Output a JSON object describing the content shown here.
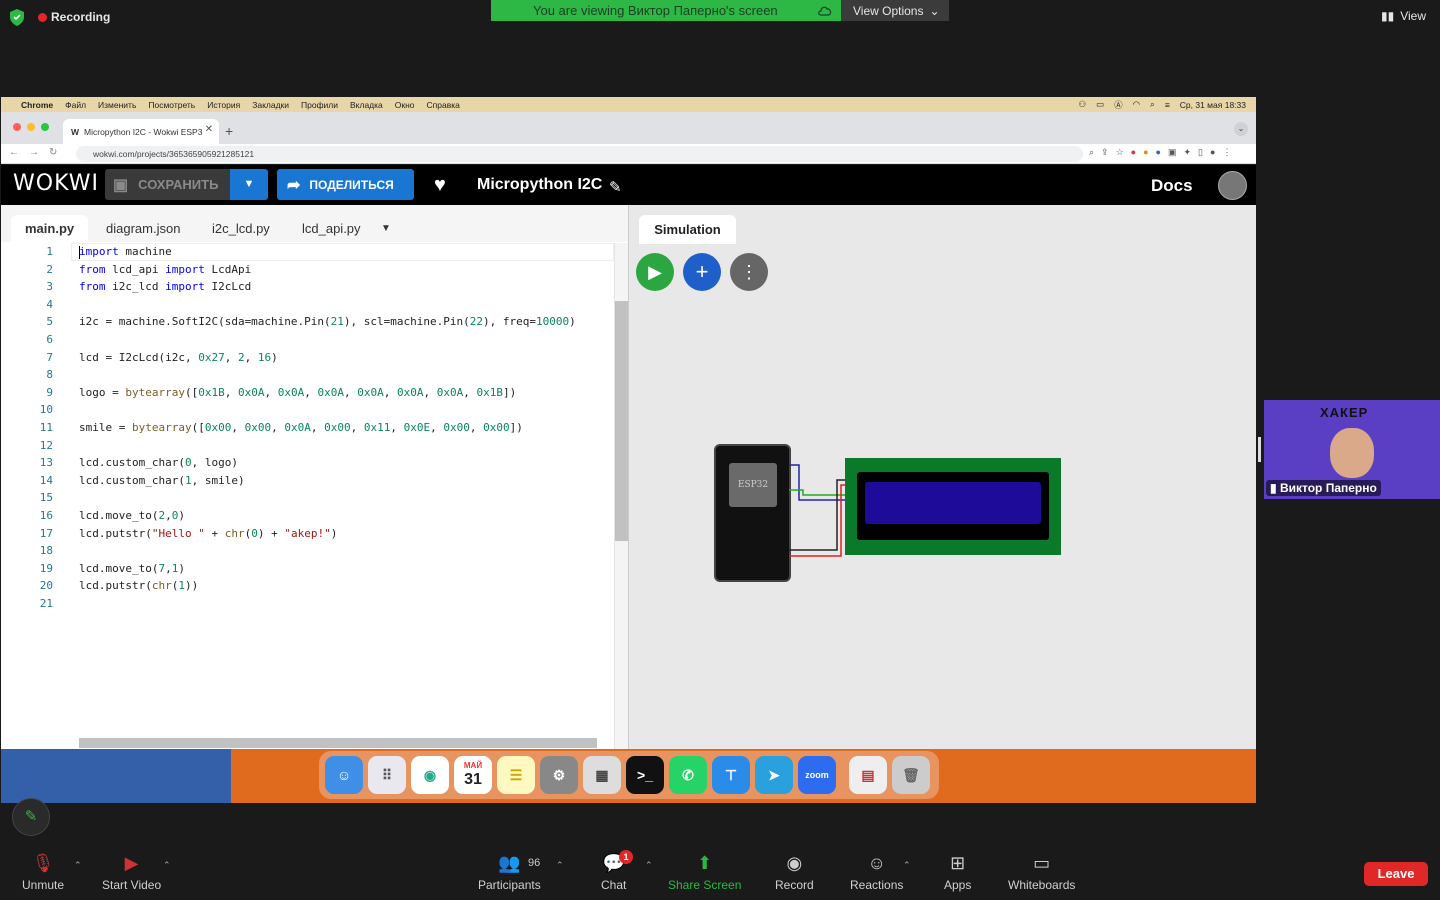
{
  "zoom": {
    "recording": "Recording",
    "viewing": "You are viewing Виктор Паперно's screen",
    "view_options": "View Options",
    "view": "View",
    "participant_count": "96",
    "chat_badge": "1",
    "participant_name": "Виктор Паперно",
    "brand": "ХАКЕР",
    "controls": {
      "unmute": "Unmute",
      "start_video": "Start Video",
      "participants": "Participants",
      "chat": "Chat",
      "share_screen": "Share Screen",
      "record": "Record",
      "reactions": "Reactions",
      "apps": "Apps",
      "whiteboards": "Whiteboards",
      "leave": "Leave"
    }
  },
  "mac": {
    "app": "Chrome",
    "menu": [
      "Файл",
      "Изменить",
      "Посмотреть",
      "История",
      "Закладки",
      "Профили",
      "Вкладка",
      "Окно",
      "Справка"
    ],
    "clock": "Ср, 31 мая  18:33"
  },
  "browser": {
    "tab_title": "Micropython I2C - Wokwi ESP3",
    "url": "wokwi.com/projects/365365905921285121"
  },
  "wokwi": {
    "logo": "WOKWI",
    "save": "СОХРАНИТЬ",
    "share": "ПОДЕЛИТЬСЯ",
    "project_title": "Micropython I2C",
    "docs": "Docs"
  },
  "editor": {
    "tabs": [
      "main.py",
      "diagram.json",
      "i2c_lcd.py",
      "lcd_api.py"
    ],
    "lines": [
      "import machine",
      "from lcd_api import LcdApi",
      "from i2c_lcd import I2cLcd",
      "",
      "i2c = machine.SoftI2C(sda=machine.Pin(21), scl=machine.Pin(22), freq=10000)",
      "",
      "lcd = I2cLcd(i2c, 0x27, 2, 16)",
      "",
      "logo = bytearray([0x1B, 0x0A, 0x0A, 0x0A, 0x0A, 0x0A, 0x0A, 0x1B])",
      "",
      "smile = bytearray([0x00, 0x00, 0x0A, 0x00, 0x11, 0x0E, 0x00, 0x00])",
      "",
      "lcd.custom_char(0, logo)",
      "lcd.custom_char(1, smile)",
      "",
      "lcd.move_to(2,0)",
      "lcd.putstr(\"Hello \" + chr(0) + \"akep!\")",
      "",
      "lcd.move_to(7,1)",
      "lcd.putstr(chr(1))",
      ""
    ]
  },
  "simulation": {
    "tab": "Simulation",
    "chip_label": "ESP32"
  },
  "dock": {
    "calendar_month": "МАЙ",
    "calendar_day": "31",
    "zoom_label": "zoom"
  }
}
